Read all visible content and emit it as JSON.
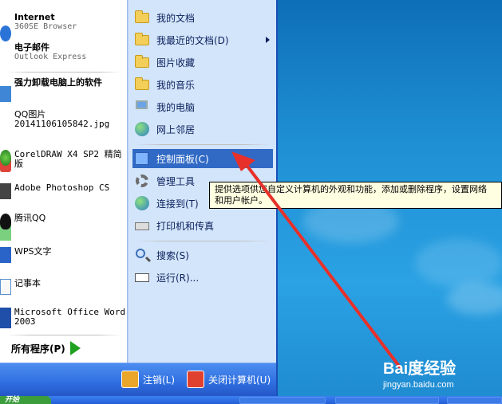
{
  "left_items": [
    {
      "title": "Internet",
      "subtitle": "360SE Browser"
    },
    {
      "title": "电子邮件",
      "subtitle": "Outlook Express"
    },
    {
      "title": "强力卸载电脑上的软件",
      "subtitle": ""
    },
    {
      "title": "QQ图片",
      "subtitle": "20141106105842.jpg"
    },
    {
      "title": "CorelDRAW X4 SP2 精简版",
      "subtitle": ""
    },
    {
      "title": "Adobe Photoshop CS",
      "subtitle": ""
    },
    {
      "title": "腾讯QQ",
      "subtitle": ""
    },
    {
      "title": "WPS文字",
      "subtitle": ""
    },
    {
      "title": "记事本",
      "subtitle": ""
    },
    {
      "title": "Microsoft Office Word",
      "subtitle": "2003"
    }
  ],
  "all_programs": "所有程序(P)",
  "right_items": [
    {
      "label": "我的文档"
    },
    {
      "label": "我最近的文档(D)"
    },
    {
      "label": "图片收藏"
    },
    {
      "label": "我的音乐"
    },
    {
      "label": "我的电脑"
    },
    {
      "label": "网上邻居"
    },
    {
      "label": "控制面板(C)"
    },
    {
      "label": "管理工具"
    },
    {
      "label": "连接到(T)"
    },
    {
      "label": "打印机和传真"
    },
    {
      "label": "搜索(S)"
    },
    {
      "label": "运行(R)..."
    }
  ],
  "bottom": {
    "logoff": "注销(L)",
    "shutdown": "关闭计算机(U)"
  },
  "taskbar": {
    "start_label": "开始"
  },
  "tooltip": {
    "line1": "提供选项供您自定义计算机的外观和功能，添加或删除程序，设置网络",
    "line2": "和用户帐户。"
  },
  "watermark": {
    "big": "Bai度经验",
    "small": "jingyan.baidu.com"
  },
  "colors": {
    "selection": "#316ac5",
    "arrow": "#e8302a",
    "menu_blue": "#2f6ee0"
  }
}
